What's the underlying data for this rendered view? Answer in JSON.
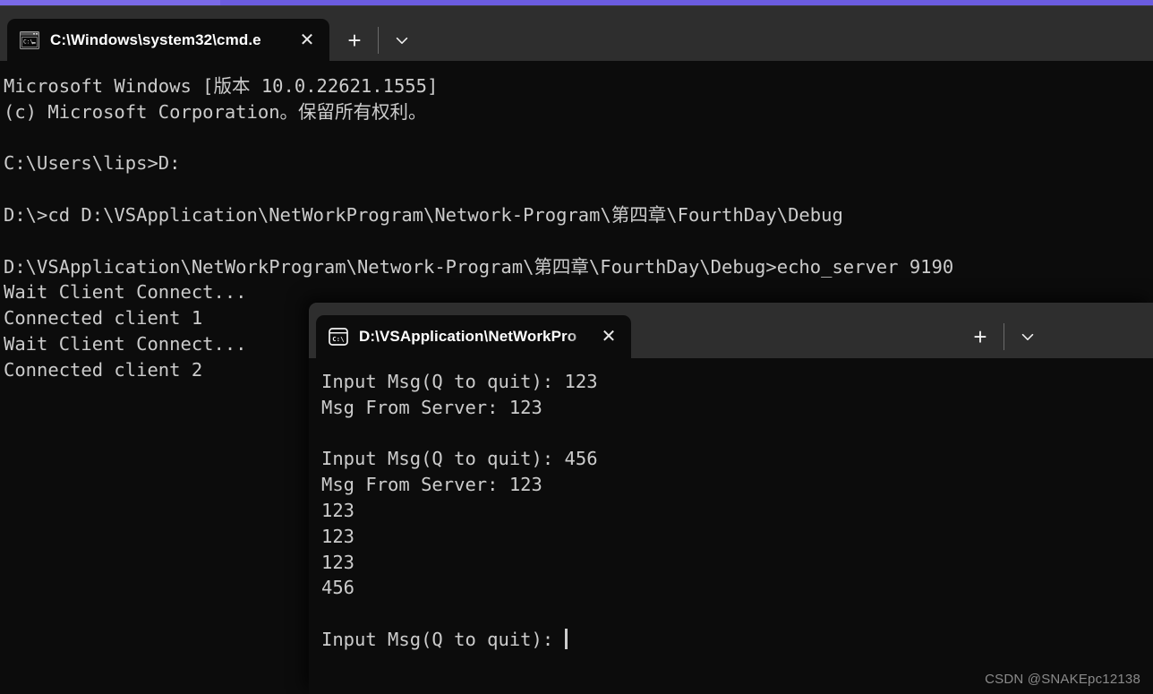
{
  "theme": {
    "accent": "#6b5ce0",
    "titlebar_bg": "#2e2e2e",
    "console_bg": "#0c0c0c",
    "console_fg": "#cccccc",
    "tab_active_bg": "#0c0c0c"
  },
  "server_window": {
    "tab": {
      "title": "C:\\Windows\\system32\\cmd.e",
      "icon": "cmd-console-icon",
      "close_label": "✕"
    },
    "actions": {
      "new_tab_label": "+",
      "dropdown_label": "⌄"
    },
    "console_text": "Microsoft Windows [版本 10.0.22621.1555]\n(c) Microsoft Corporation。保留所有权利。\n\nC:\\Users\\lips>D:\n\nD:\\>cd D:\\VSApplication\\NetWorkProgram\\Network-Program\\第四章\\FourthDay\\Debug\n\nD:\\VSApplication\\NetWorkProgram\\Network-Program\\第四章\\FourthDay\\Debug>echo_server 9190\nWait Client Connect...\nConnected client 1\nWait Client Connect...\nConnected client 2"
  },
  "client_window": {
    "tab": {
      "title": "D:\\VSApplication\\NetWorkPro",
      "icon": "terminal-cmd-profile-icon",
      "close_label": "✕"
    },
    "actions": {
      "new_tab_label": "+",
      "dropdown_label": "⌄"
    },
    "console_text": "Input Msg(Q to quit): 123\nMsg From Server: 123\n\nInput Msg(Q to quit): 456\nMsg From Server: 123\n123\n123\n123\n456\n\nInput Msg(Q to quit): "
  },
  "watermark": {
    "text": "CSDN @SNAKEpc12138"
  }
}
